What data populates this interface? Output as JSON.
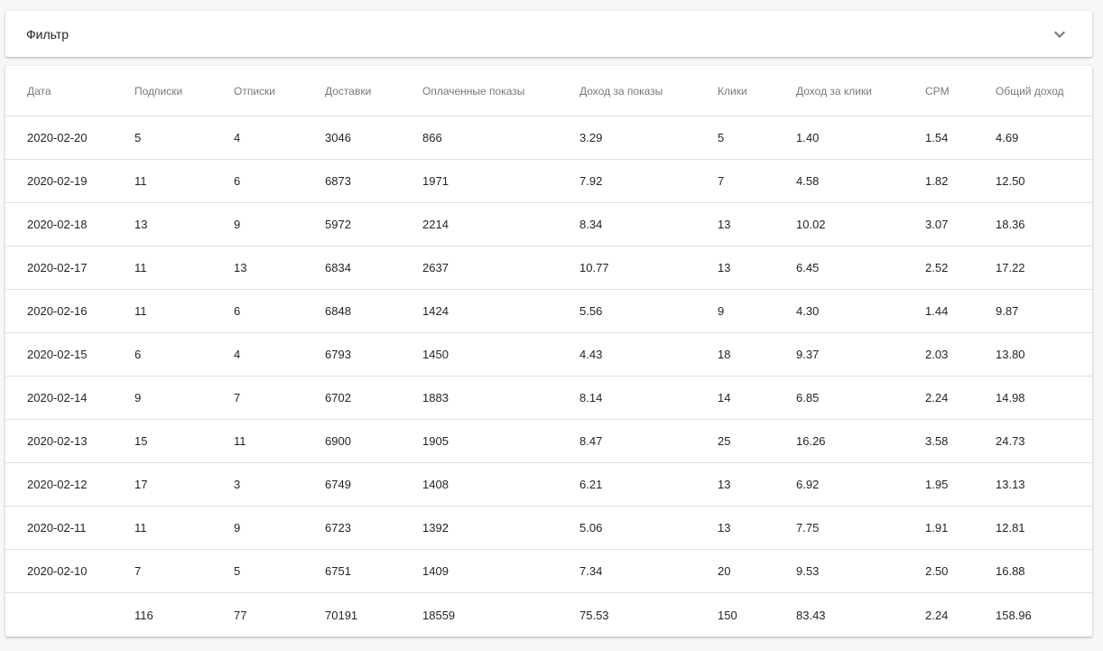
{
  "filter": {
    "title": "Фильтр",
    "toggle_icon": "chevron-down-icon"
  },
  "table": {
    "columns": [
      "Дата",
      "Подписки",
      "Отписки",
      "Доставки",
      "Оплаченные показы",
      "Доход за показы",
      "Клики",
      "Доход за клики",
      "CPM",
      "Общий доход"
    ],
    "rows": [
      [
        "2020-02-20",
        "5",
        "4",
        "3046",
        "866",
        "3.29",
        "5",
        "1.40",
        "1.54",
        "4.69"
      ],
      [
        "2020-02-19",
        "11",
        "6",
        "6873",
        "1971",
        "7.92",
        "7",
        "4.58",
        "1.82",
        "12.50"
      ],
      [
        "2020-02-18",
        "13",
        "9",
        "5972",
        "2214",
        "8.34",
        "13",
        "10.02",
        "3.07",
        "18.36"
      ],
      [
        "2020-02-17",
        "11",
        "13",
        "6834",
        "2637",
        "10.77",
        "13",
        "6.45",
        "2.52",
        "17.22"
      ],
      [
        "2020-02-16",
        "11",
        "6",
        "6848",
        "1424",
        "5.56",
        "9",
        "4.30",
        "1.44",
        "9.87"
      ],
      [
        "2020-02-15",
        "6",
        "4",
        "6793",
        "1450",
        "4.43",
        "18",
        "9.37",
        "2.03",
        "13.80"
      ],
      [
        "2020-02-14",
        "9",
        "7",
        "6702",
        "1883",
        "8.14",
        "14",
        "6.85",
        "2.24",
        "14.98"
      ],
      [
        "2020-02-13",
        "15",
        "11",
        "6900",
        "1905",
        "8.47",
        "25",
        "16.26",
        "3.58",
        "24.73"
      ],
      [
        "2020-02-12",
        "17",
        "3",
        "6749",
        "1408",
        "6.21",
        "13",
        "6.92",
        "1.95",
        "13.13"
      ],
      [
        "2020-02-11",
        "11",
        "9",
        "6723",
        "1392",
        "5.06",
        "13",
        "7.75",
        "1.91",
        "12.81"
      ],
      [
        "2020-02-10",
        "7",
        "5",
        "6751",
        "1409",
        "7.34",
        "20",
        "9.53",
        "2.50",
        "16.88"
      ]
    ],
    "totals": [
      "",
      "116",
      "77",
      "70191",
      "18559",
      "75.53",
      "150",
      "83.43",
      "2.24",
      "158.96"
    ]
  }
}
